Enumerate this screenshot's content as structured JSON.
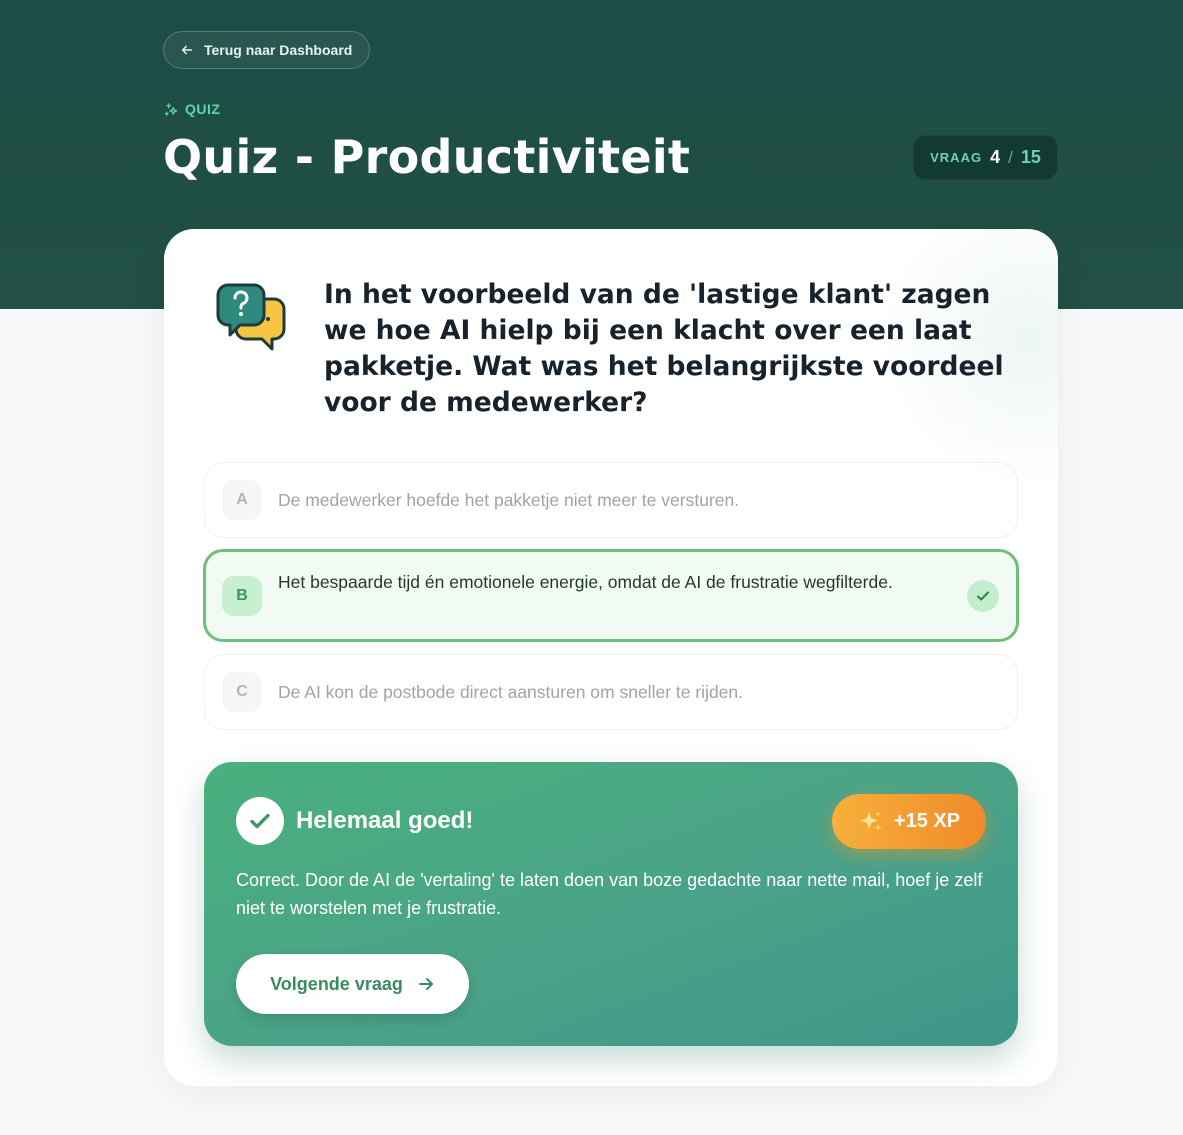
{
  "header": {
    "back_label": "Terug naar Dashboard",
    "eyebrow": "QUIZ",
    "title": "Quiz - Productiviteit",
    "counter": {
      "label": "VRAAG",
      "current": "4",
      "separator": "/",
      "total": "15"
    }
  },
  "question": {
    "text": "In het voorbeeld van de 'lastige klant' zagen we hoe AI hielp bij een klacht over een laat pakketje. Wat was het belangrijkste voordeel voor de medewerker?",
    "options": [
      {
        "letter": "A",
        "text": "De medewerker hoefde het pakketje niet meer te versturen.",
        "state": "dimmed"
      },
      {
        "letter": "B",
        "text": "Het bespaarde tijd én emotionele energie, omdat de AI de frustratie wegfilterde.",
        "state": "correct"
      },
      {
        "letter": "C",
        "text": "De AI kon de postbode direct aansturen om sneller te rijden.",
        "state": "dimmed"
      }
    ]
  },
  "result": {
    "title": "Helemaal goed!",
    "xp": "+15 XP",
    "text": "Correct. Door de AI de 'vertaling' te laten doen van boze gedachte naar nette mail, hoef je zelf niet te worstelen met je frustratie.",
    "next_label": "Volgende vraag"
  },
  "colors": {
    "hero": "#1d4d45",
    "accent": "#5fd5ae",
    "correct_border": "#6cc07a",
    "result_bg": "#4aa288",
    "xp_badge": "#f39a30"
  },
  "icons": {
    "back": "arrow-left-icon",
    "eyebrow": "sparkles-icon",
    "question": "chat-question-icon",
    "correct": "check-icon",
    "xp": "sparkle-icon",
    "next": "arrow-right-icon"
  }
}
